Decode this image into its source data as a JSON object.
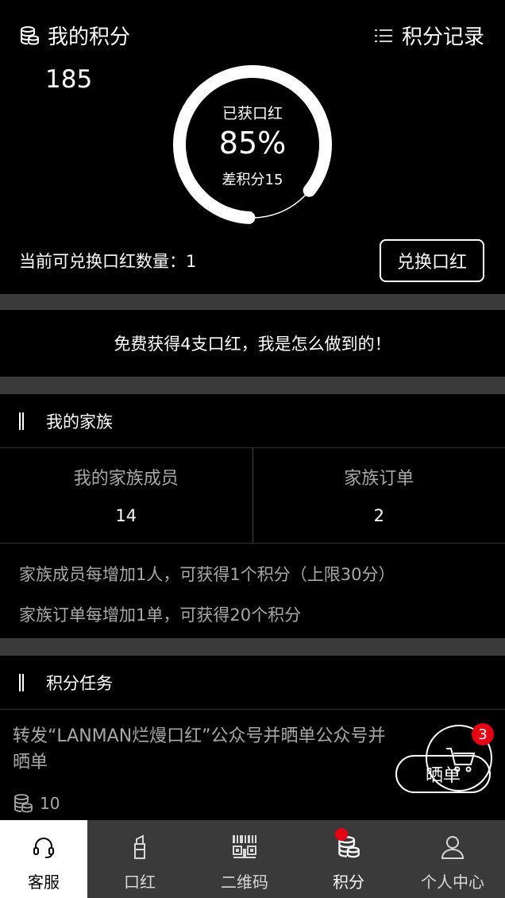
{
  "header": {
    "title": "我的积分",
    "points": "185",
    "record_label": "积分记录"
  },
  "progress": {
    "label": "已获口红",
    "percent_text": "85%",
    "percent": 0.85,
    "diff_text": "差积分15"
  },
  "exchange": {
    "available_text": "当前可兑换口红数量：1",
    "button_label": "兑换口红"
  },
  "banner": {
    "text": "免费获得4支口红，我是怎么做到的！"
  },
  "family": {
    "section_title": "我的家族",
    "members_label": "我的家族成员",
    "members_value": "14",
    "orders_label": "家族订单",
    "orders_value": "2",
    "rules": [
      "家族成员每增加1人，可获得1个积分（上限30分）",
      "家族订单每增加1单，可获得20个积分"
    ]
  },
  "tasks": {
    "section_title": "积分任务",
    "items": [
      {
        "text": "转发“LANMAN烂熳口红”公众号并晒单公众号并晒单",
        "points": "10"
      }
    ],
    "share_label": "晒单",
    "cart_badge": "3"
  },
  "tabbar": {
    "items": [
      {
        "label": "客服",
        "icon": "headset-icon",
        "active": true
      },
      {
        "label": "口红",
        "icon": "lipstick-icon",
        "active": false
      },
      {
        "label": "二维码",
        "icon": "qrcode-icon",
        "active": false
      },
      {
        "label": "积分",
        "icon": "coins-icon",
        "active": false
      },
      {
        "label": "个人中心",
        "icon": "user-icon",
        "active": false
      }
    ]
  },
  "colors": {
    "background": "#000000",
    "separator": "#3a3a3a",
    "accent_red": "#e60012",
    "muted_text": "#a8a8a8"
  }
}
